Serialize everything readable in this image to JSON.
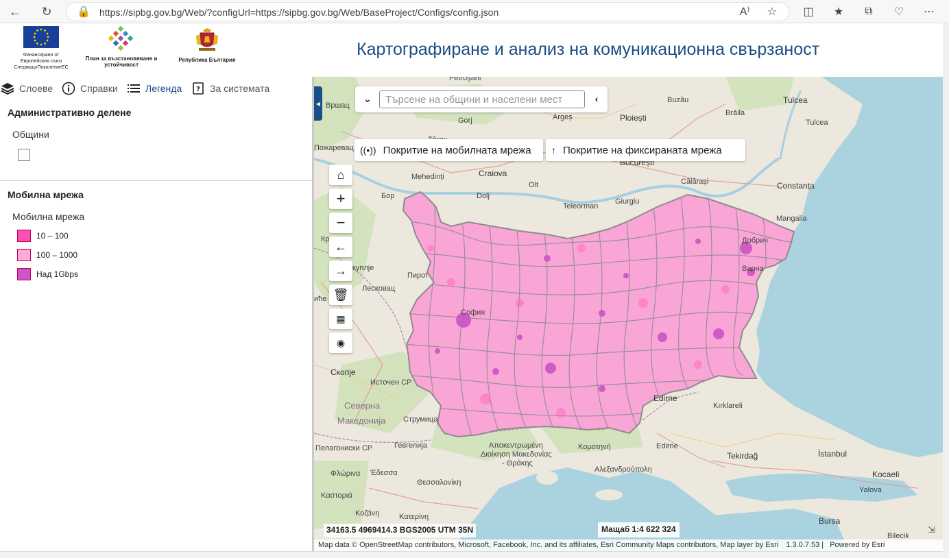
{
  "browser": {
    "url": "https://sipbg.gov.bg/Web/?configUrl=https://sipbg.gov.bg/Web/BaseProject/Configs/config.json",
    "read_aloud": "A⁾"
  },
  "header": {
    "logo_eu_caption": "Финансирано от Европейския съюз СледващоПоколениеЕС",
    "logo_plan_caption": "План за възстановяване и устойчивост",
    "logo_bg_caption": "Република България",
    "title": "Картографиране и анализ на комуникационна свързаност"
  },
  "tabs": [
    {
      "label": "Слоеве"
    },
    {
      "label": "Справки"
    },
    {
      "label": "Легенда"
    },
    {
      "label": "За системата"
    }
  ],
  "legend": {
    "admin_title": "Административно делене",
    "admin_sub": "Общини",
    "mobile_title": "Мобилна мрежа",
    "mobile_sub": "Мобилна мрежа",
    "items": [
      {
        "label": "10 – 100",
        "color": "#ff4fb0"
      },
      {
        "label": "100 – 1000",
        "color": "#ffaad8"
      },
      {
        "label": "Над 1Gbps",
        "color": "#cc55c8"
      }
    ]
  },
  "map": {
    "search_placeholder": "Търсене на общини и населени мест",
    "mobile_coverage": "Покритие на мобилната мрежа",
    "fixed_coverage": "Покритие на фиксираната мрежа",
    "coords": "34163.5 4969414.3 BGS2005 UTM 35N",
    "scale": "Мащаб 1:4 622 324",
    "attribution": "Map data © OpenStreetMap contributors, Microsoft, Facebook, Inc. and its affiliates, Esri Community Maps contributors, Map layer by Esri",
    "version": "1.3.0.7.53 |",
    "powered": "Powered by Esri",
    "labels": {
      "petrosani": "Petroşani",
      "vrshats": "Вршац",
      "targu_jiu": "Gorj",
      "arges": "Argeș",
      "buzau": "Buzău",
      "tulcea_top": "Tulcea",
      "braila": "Brăila",
      "ploiesti": "Ploiești",
      "tulcea": "Tulcea",
      "pozharevats": "Пожаревац",
      "targu": "Târgu",
      "bucuresti": "București",
      "mehedinti": "Mehedinți",
      "craiova": "Craiova",
      "calarasi": "Călărași",
      "constanta": "Constanța",
      "olt": "Olt",
      "bor": "Бор",
      "dolj": "Dolj",
      "teleorman": "Teleorman",
      "giurgiu": "Giurgiu",
      "mangalia": "Mangalia",
      "kr": "Кр",
      "dobrich": "Добрич",
      "varna": "Варна",
      "kuplje": "куплје",
      "pirot": "Пирот",
      "leskovac": "Лесковац",
      "vice": "иће",
      "sofia": "София",
      "skopje": "Скопје",
      "istochen": "Источен СР",
      "edirne_city": "Edirne",
      "kirklareli": "Kırklareli",
      "severna": "Северна",
      "makedonija": "Македонија",
      "strumica": "Струмица",
      "gevgelija": "Гевгелија",
      "pelag": "Пелагониски СР",
      "apokentr": "Αποκεντρωμένη",
      "dioikisi": "Διοίκηση Μακεδονίας",
      "thrakis": "- Θράκης",
      "komotini": "Κομοτηνή",
      "edirne": "Edirne",
      "tekirdag": "Tekirdağ",
      "istanbul": "İstanbul",
      "florina": "Φλώρινα",
      "edessa": "Έδεσσα",
      "alexandroupoli": "Αλεξανδρούπολη",
      "kocaeli": "Kocaeli",
      "thessaloniki": "Θεσσαλονίκη",
      "yalova": "Yalova",
      "kastoria": "Καστοριά",
      "kozani": "Κοζάνη",
      "katerini": "Κατερίνη",
      "bursa": "Bursa",
      "bilecik": "Bilecik"
    }
  }
}
